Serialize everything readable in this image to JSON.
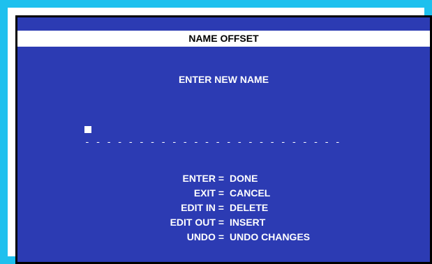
{
  "window": {
    "title": "NAME OFFSET"
  },
  "prompt": "ENTER NEW NAME",
  "name_field": {
    "value": "",
    "underline": "- - - - - - - - - - - - - - - - - - - - - - - -"
  },
  "key_help": [
    {
      "key": "ENTER =",
      "action": "DONE"
    },
    {
      "key": "EXIT =",
      "action": "CANCEL"
    },
    {
      "key": "EDIT IN =",
      "action": "DELETE"
    },
    {
      "key": "EDIT OUT =",
      "action": "INSERT"
    },
    {
      "key": "UNDO =",
      "action": "UNDO CHANGES"
    }
  ],
  "colors": {
    "border": "#1ec0ee",
    "background": "#2c3bb3",
    "title_bar": "#ffffff",
    "text": "#ffffff"
  }
}
